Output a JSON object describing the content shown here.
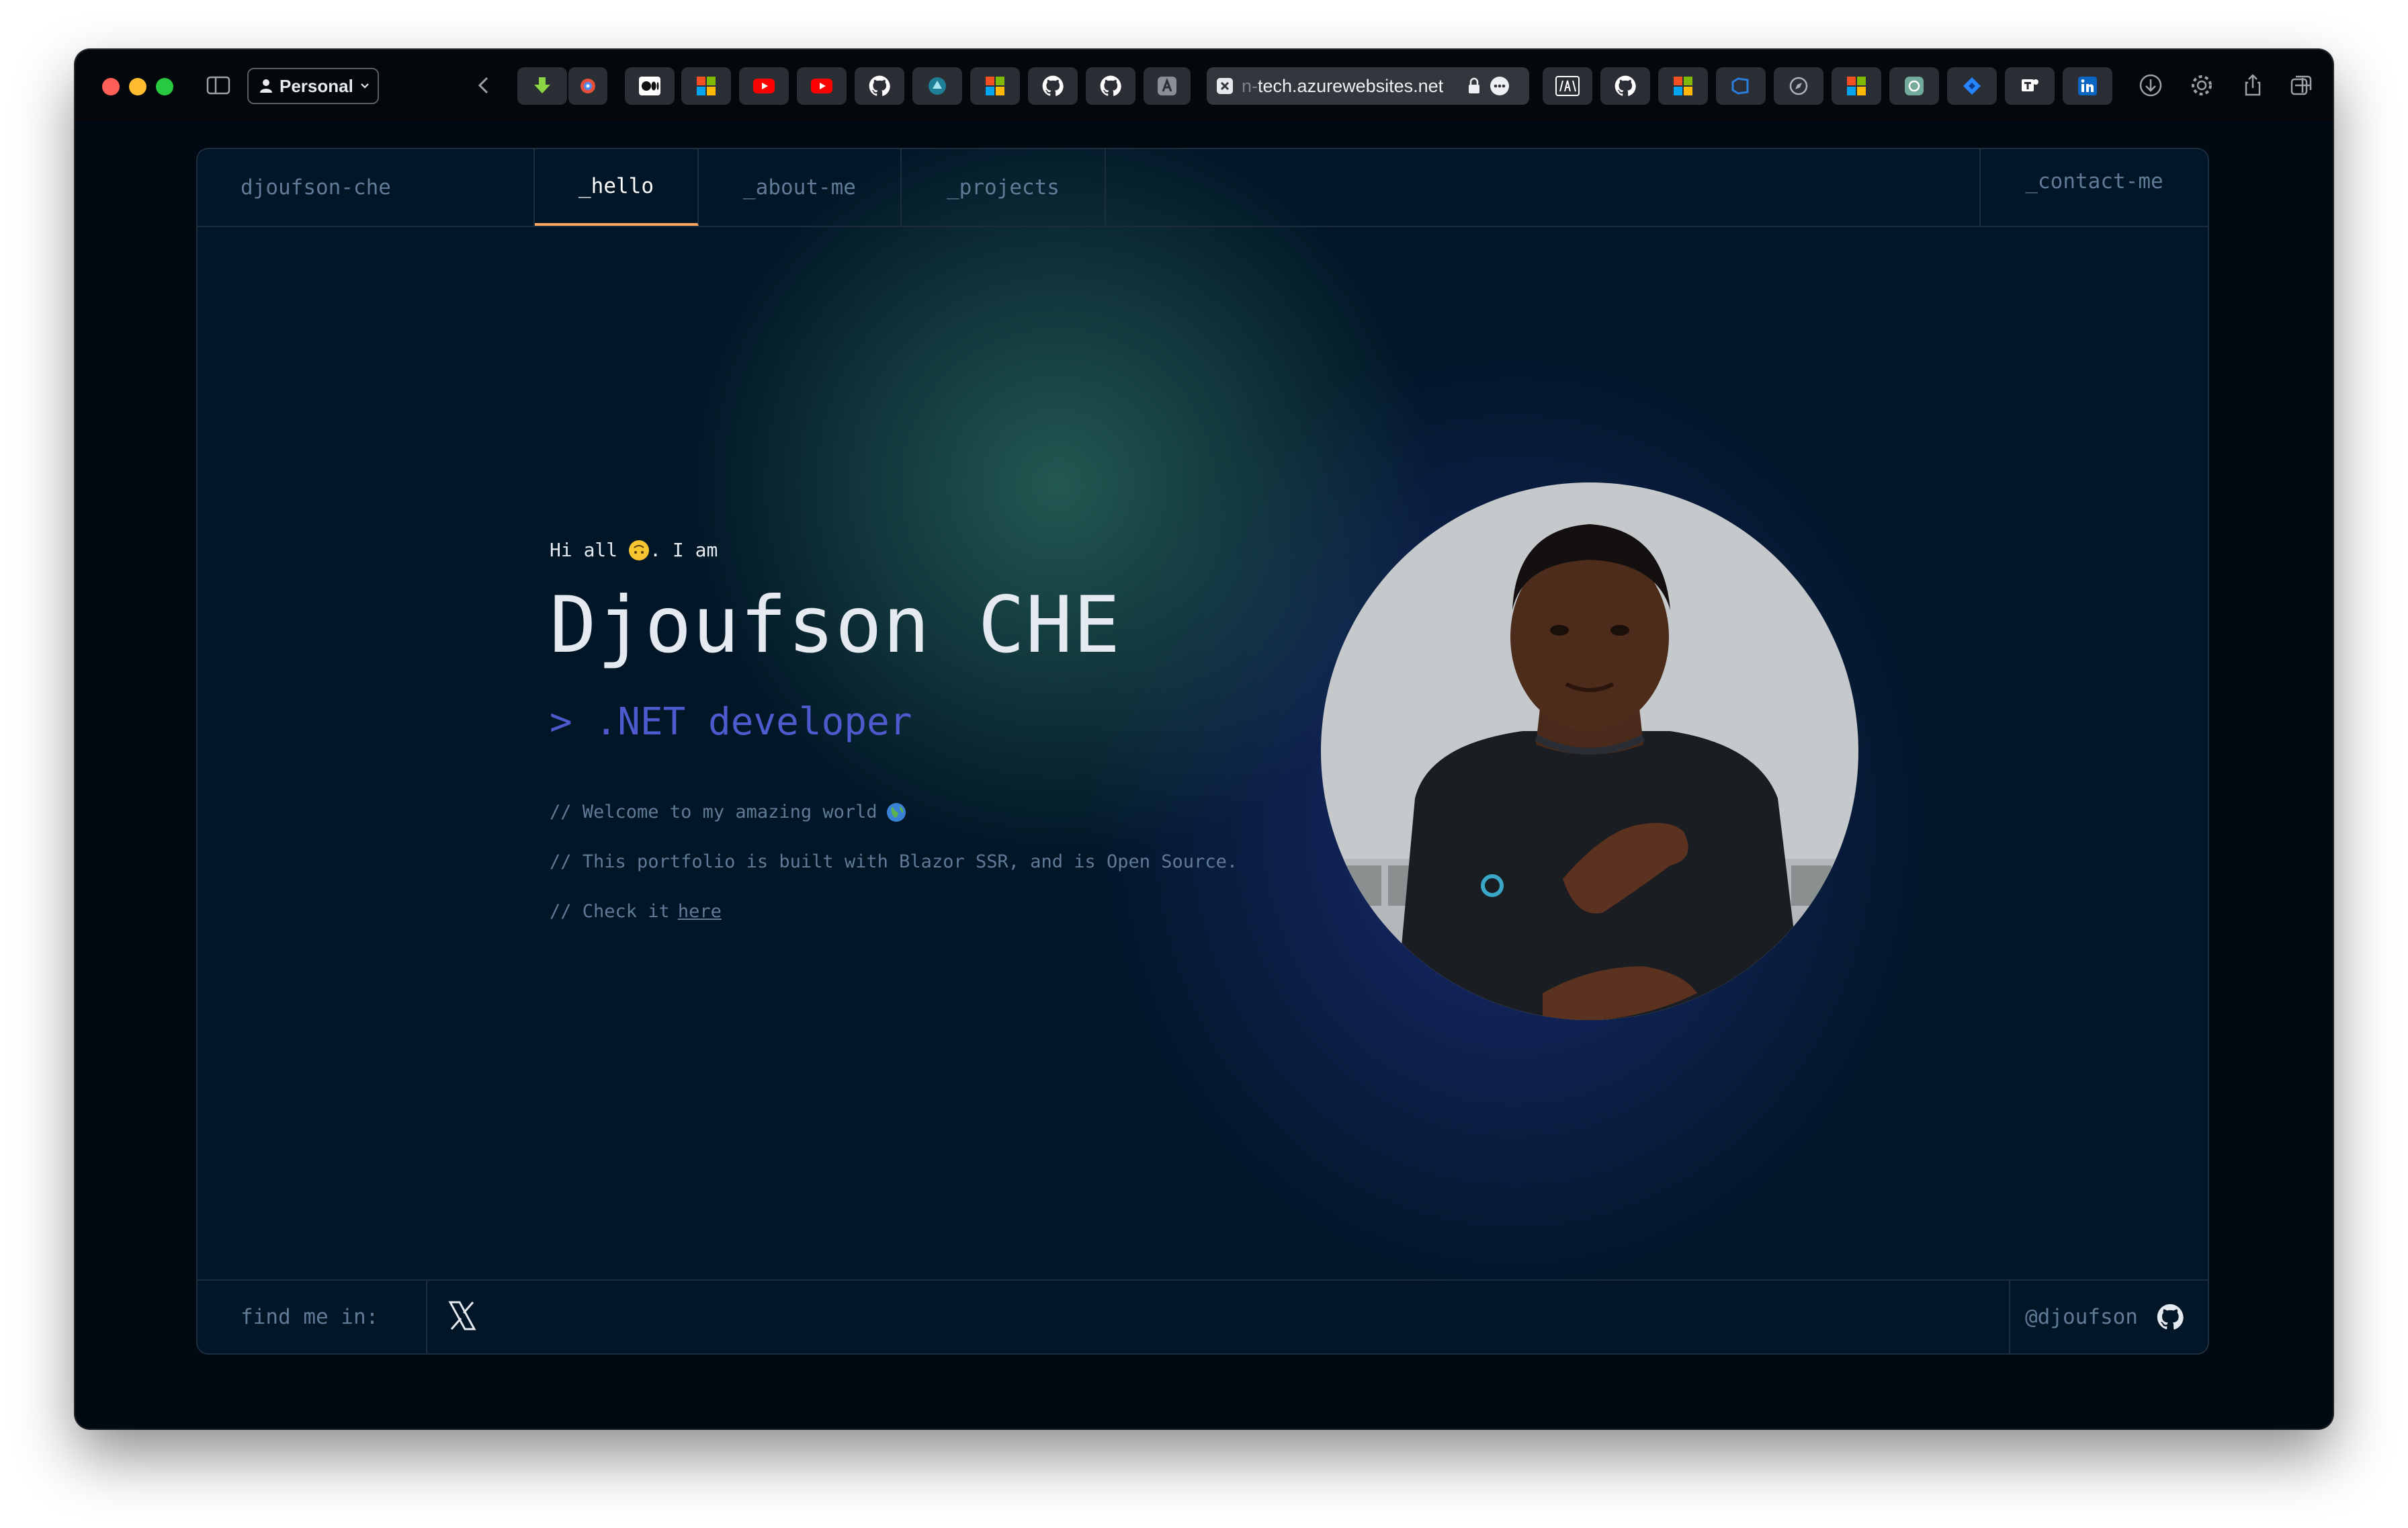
{
  "browser": {
    "profile_label": "Personal",
    "url_prefix": "n-",
    "url_rest": "tech.azurewebsites.net",
    "tabs_left": [
      "download-icon",
      "extension-icon",
      "medium-icon",
      "microsoft-icon",
      "youtube-icon",
      "youtube-icon",
      "github-icon",
      "azure-icon",
      "microsoft-icon",
      "github-icon",
      "github-icon",
      "font-icon"
    ],
    "tabs_right": [
      "aws-icon",
      "github-icon",
      "microsoft-icon",
      "azure-devops-icon",
      "compass-icon",
      "microsoft-icon",
      "chatgpt-icon",
      "jira-icon",
      "teams-icon",
      "linkedin-icon"
    ]
  },
  "nav": {
    "brand": "djoufson-che",
    "hello": "_hello",
    "about": "_about-me",
    "projects": "_projects",
    "contact": "_contact-me"
  },
  "hero": {
    "greeting_prefix": "Hi all",
    "greeting_suffix": ". I am",
    "name": "Djoufson CHE",
    "role": "> .NET developer",
    "comment_1": "// Welcome to my amazing world",
    "comment_2": "// This portfolio is built with Blazor SSR, and is Open Source.",
    "comment_3_prefix": "// Check it",
    "comment_3_link": "here"
  },
  "footer": {
    "find_label": "find me in:",
    "handle": "@djoufson"
  },
  "colors": {
    "background": "#011627",
    "accent_orange": "#fea55f",
    "role_blue": "#4d5bce",
    "muted_text": "#607b96",
    "border": "#1e2d3d"
  }
}
